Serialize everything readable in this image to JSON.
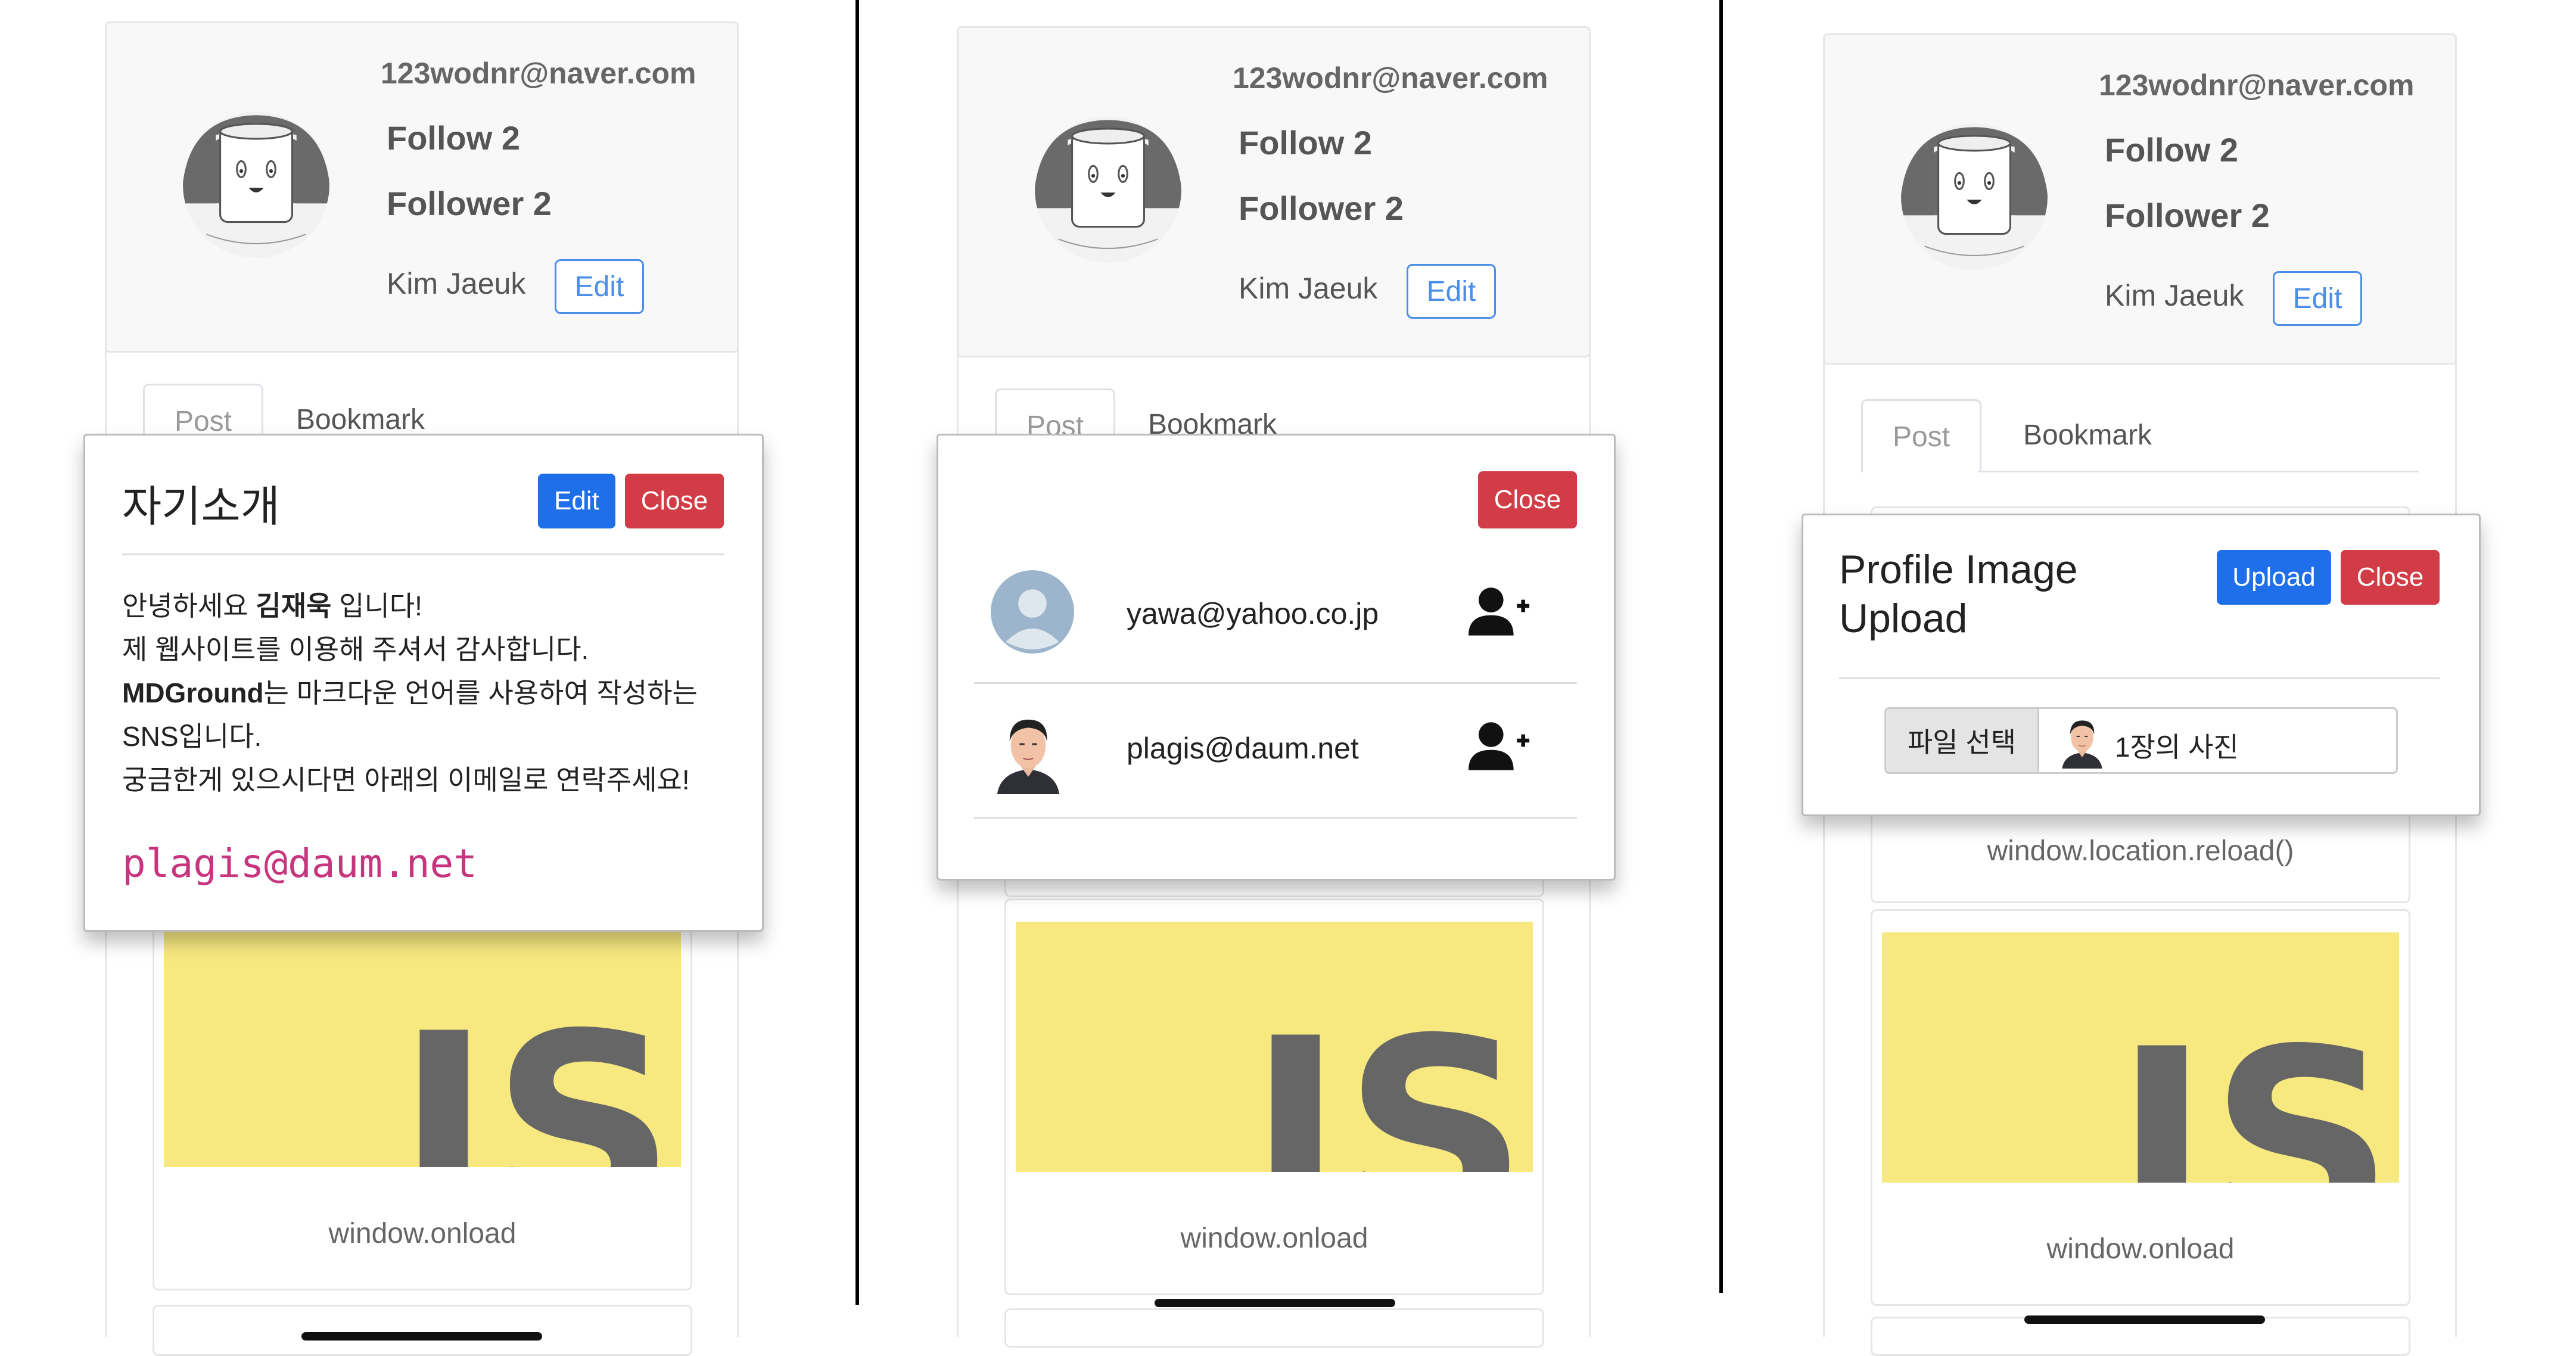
{
  "profile": {
    "email": "123wodnr@naver.com",
    "follow": "Follow 2",
    "follower": "Follower 2",
    "name": "Kim Jaeuk",
    "edit_label": "Edit"
  },
  "tabs": {
    "post": "Post",
    "bookmark": "Bookmark"
  },
  "posts": {
    "first_caption": "window.onload",
    "reload_caption": "window.location.reload()"
  },
  "js_logo_text": "JS",
  "intro_modal": {
    "title": "자기소개",
    "edit_label": "Edit",
    "close_label": "Close",
    "line1_pre": "안녕하세요 ",
    "line1_bold": "김재욱",
    "line1_post": " 입니다!",
    "line2": "제 웹사이트를 이용해 주셔서 감사합니다.",
    "line3_bold": "MDGround",
    "line3_post": "는 마크다운 언어를 사용하여 작성하는",
    "line4": "SNS입니다.",
    "line5": "궁금한게 있으시다면 아래의 이메일로 연락주세요!",
    "email_code": "plagis@daum.net"
  },
  "follow_modal": {
    "close_label": "Close",
    "users": [
      {
        "email": "yawa@yahoo.co.jp",
        "avatar": "default-avatar",
        "action_icon": "user-plus-icon"
      },
      {
        "email": "plagis@daum.net",
        "avatar": "portrait-avatar",
        "action_icon": "user-plus-icon"
      }
    ]
  },
  "upload_modal": {
    "title_line1": "Profile Image",
    "title_line2": "Upload",
    "upload_label": "Upload",
    "close_label": "Close",
    "file_button": "파일 선택",
    "file_status": "1장의 사진"
  },
  "colors": {
    "primary": "#1f6fea",
    "danger": "#d23c46",
    "outline_blue": "#4a8ee8",
    "code_pink": "#c7357f",
    "js_yellow": "#f7e880"
  }
}
